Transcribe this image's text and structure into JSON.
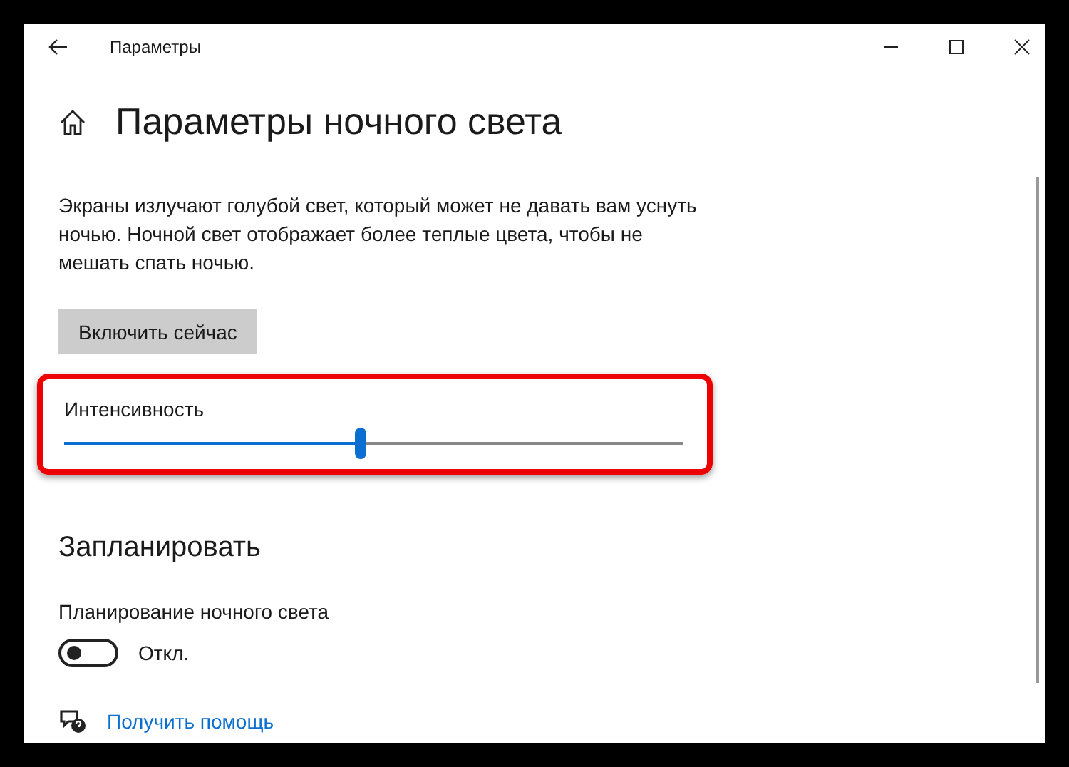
{
  "window": {
    "title": "Параметры"
  },
  "page": {
    "heading": "Параметры ночного света",
    "description": "Экраны излучают голубой свет, который может не давать вам уснуть ночью. Ночной свет отображает более теплые цвета, чтобы не мешать спать ночью.",
    "button": "Включить сейчас"
  },
  "intensity": {
    "label": "Интенсивность",
    "level": 0.48,
    "highlighted": true
  },
  "schedule": {
    "heading": "Запланировать",
    "label": "Планирование ночного света",
    "on": false,
    "state_text": "Откл."
  },
  "help": {
    "link": "Получить помощь"
  }
}
